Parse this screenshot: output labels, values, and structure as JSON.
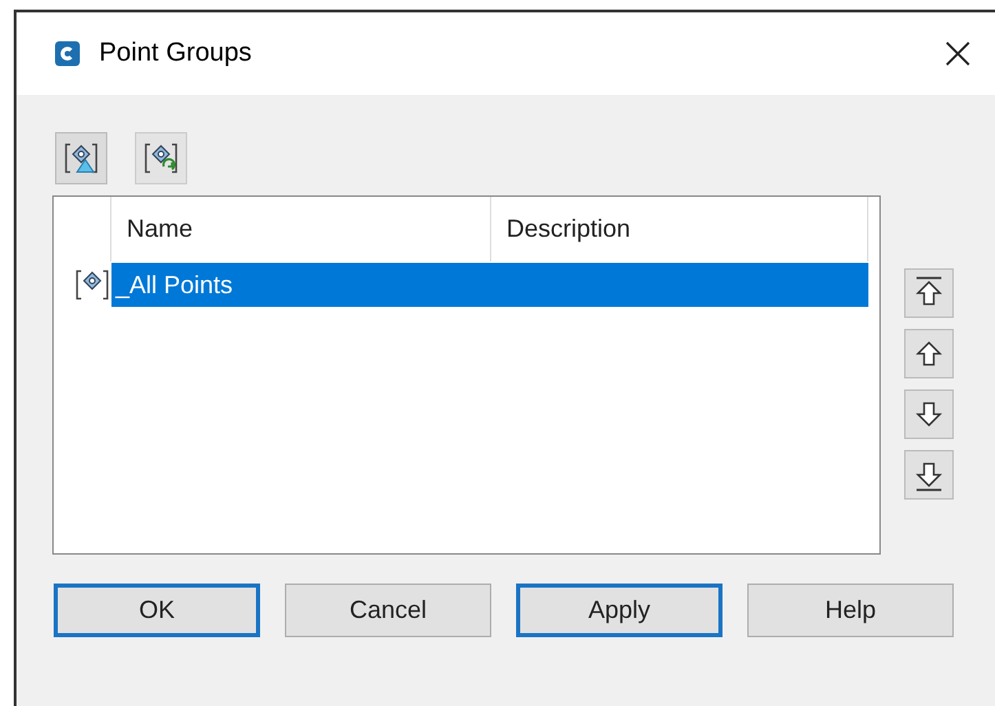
{
  "window": {
    "title": "Point Groups"
  },
  "table": {
    "columns": [
      "Name",
      "Description"
    ],
    "rows": [
      {
        "name": "_All Points",
        "description": "",
        "selected": true
      }
    ]
  },
  "move_buttons": [
    {
      "kind": "top"
    },
    {
      "kind": "up"
    },
    {
      "kind": "down"
    },
    {
      "kind": "bottom"
    }
  ],
  "buttons": [
    {
      "label": "OK",
      "highlighted": true
    },
    {
      "label": "Cancel",
      "highlighted": false
    },
    {
      "label": "Apply",
      "highlighted": true
    },
    {
      "label": "Help",
      "highlighted": false
    }
  ]
}
